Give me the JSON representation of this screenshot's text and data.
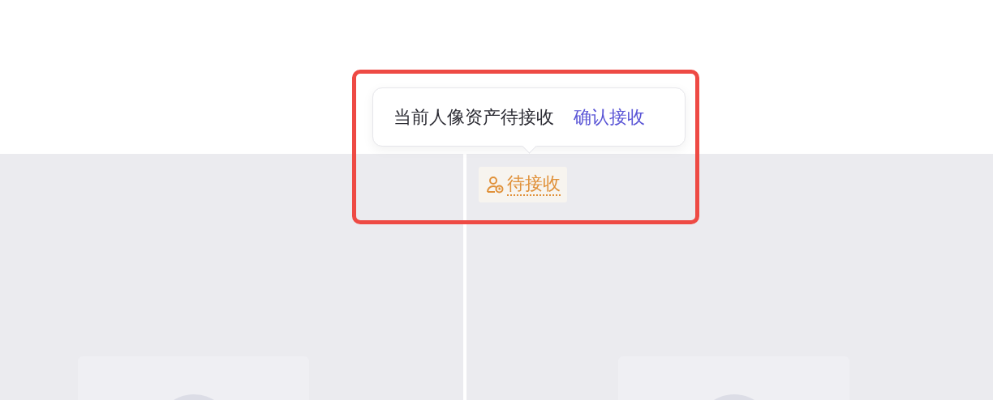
{
  "columns": [
    {
      "kind": "portrait-slot"
    },
    {
      "kind": "portrait-slot"
    }
  ],
  "tooltip": {
    "message": "当前人像资产待接收",
    "action": "确认接收",
    "highlighted": true
  },
  "status_badge": {
    "label": "待接收"
  }
}
